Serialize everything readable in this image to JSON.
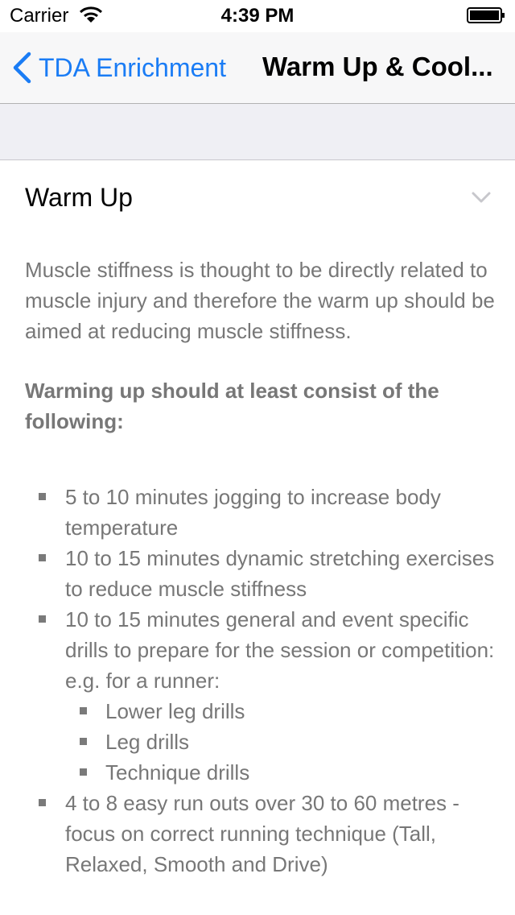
{
  "status_bar": {
    "carrier": "Carrier",
    "time": "4:39 PM"
  },
  "nav": {
    "back_label": "TDA Enrichment",
    "title": "Warm Up & Cool..."
  },
  "section": {
    "title": "Warm Up",
    "chevron_icon": "chevron-down-icon"
  },
  "content": {
    "intro": "Muscle stiffness is thought to be directly related to muscle injury and therefore the warm up should be aimed at reducing muscle stiffness.",
    "bold_heading": "Warming up should at least consist of the following:",
    "items": [
      "5 to 10 minutes jogging to increase body temperature",
      "10 to 15 minutes dynamic stretching exercises to reduce muscle stiffness",
      "10 to 15 minutes general and event specific drills to prepare for the session or competition: e.g. for a runner:",
      "4 to 8 easy run outs over 30 to 60 metres - focus on correct running technique (Tall, Relaxed, Smooth and Drive)"
    ],
    "sub_items": [
      "Lower leg drills",
      "Leg drills",
      "Technique drills"
    ]
  },
  "colors": {
    "accent": "#1a7cf5",
    "body_text": "#777777",
    "nav_bg": "#f7f7f8",
    "band_bg": "#efeff4"
  }
}
